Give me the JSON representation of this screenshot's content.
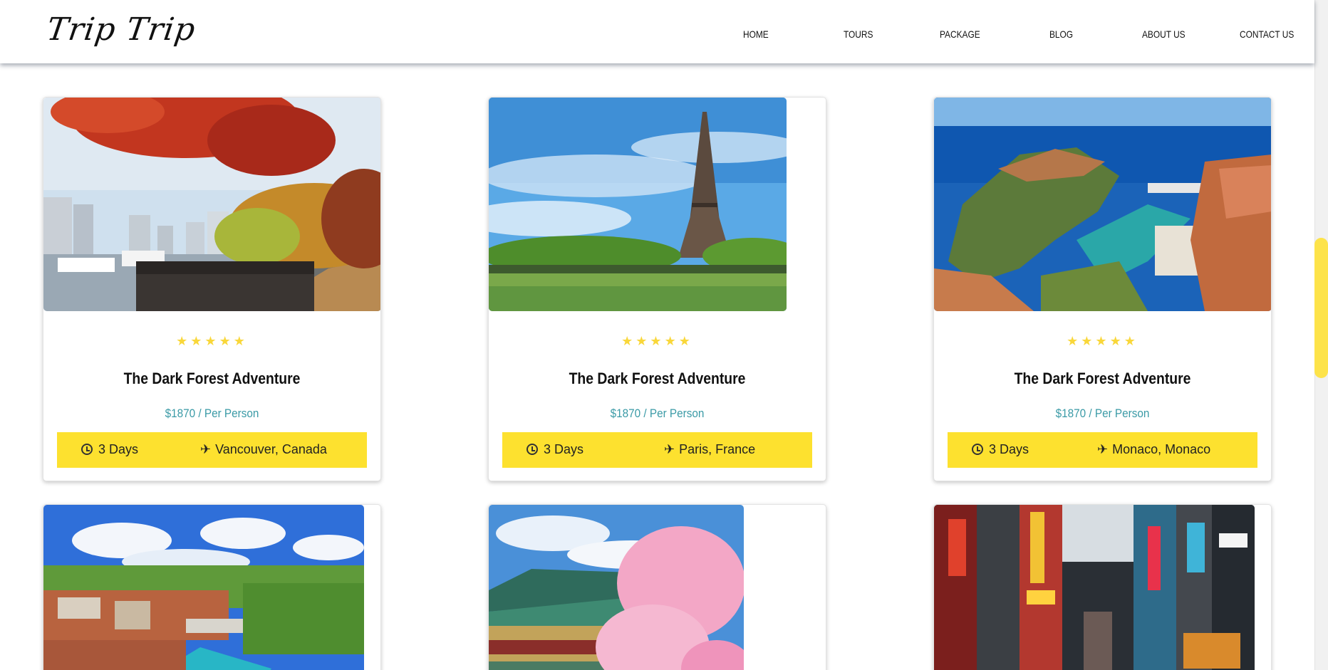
{
  "brand": {
    "logo": "Trip Trip"
  },
  "nav": {
    "home": "HOME",
    "tours": "TOURS",
    "package": "PACKAGE",
    "blog": "BLOG",
    "about": "ABOUT US",
    "contact": "CONTACT US"
  },
  "icons": {
    "star": "star-icon",
    "clock": "clock-icon",
    "plane": "plane-icon"
  },
  "colors": {
    "accent_yellow": "#fde12f",
    "star": "#f9d73a",
    "price_teal": "#3a9aa6"
  },
  "cards": [
    {
      "rating": 5,
      "stars": "★★★★★",
      "title": "The Dark Forest Adventure",
      "price": "$1870 / Per Person",
      "duration": "3 Days",
      "location": "Vancouver, Canada"
    },
    {
      "rating": 5,
      "stars": "★★★★★",
      "title": "The Dark Forest Adventure",
      "price": "$1870 / Per Person",
      "duration": "3 Days",
      "location": "Paris, France"
    },
    {
      "rating": 5,
      "stars": "★★★★★",
      "title": "The Dark Forest Adventure",
      "price": "$1870 / Per Person",
      "duration": "3 Days",
      "location": "Monaco, Monaco"
    }
  ]
}
